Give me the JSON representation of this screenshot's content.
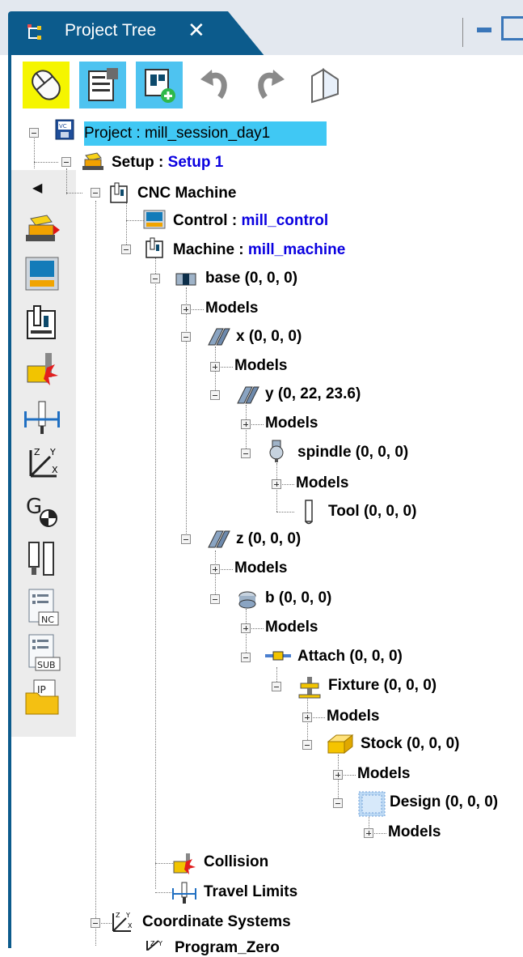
{
  "tab": {
    "title": "Project Tree",
    "close": "✕"
  },
  "toolbar": {
    "buttons": [
      {
        "name": "select-mode-icon"
      },
      {
        "name": "properties-icon"
      },
      {
        "name": "add-component-icon"
      },
      {
        "name": "undo-icon"
      },
      {
        "name": "redo-icon"
      },
      {
        "name": "view-icon"
      }
    ]
  },
  "sidebar": {
    "collapse_arrow": "◀",
    "buttons": [
      {
        "name": "setup-icon"
      },
      {
        "name": "control-icon"
      },
      {
        "name": "machine-icon"
      },
      {
        "name": "collision-icon"
      },
      {
        "name": "travel-limits-icon"
      },
      {
        "name": "coordinate-systems-icon"
      },
      {
        "name": "g-code-offsets-icon"
      },
      {
        "name": "tools-icon"
      },
      {
        "name": "nc-programs-icon",
        "label": "NC"
      },
      {
        "name": "subroutines-icon",
        "label": "SUB"
      },
      {
        "name": "ip-folder-icon",
        "label": "IP"
      }
    ]
  },
  "tree": {
    "project": {
      "label": "Project : mill_session_day1"
    },
    "setup": {
      "label": "Setup :",
      "value": "Setup 1"
    },
    "cnc_machine": {
      "label": "CNC Machine"
    },
    "control": {
      "label": "Control :",
      "value": "mill_control"
    },
    "machine": {
      "label": "Machine :",
      "value": "mill_machine"
    },
    "base": {
      "label": "base (0, 0, 0)"
    },
    "base_models": {
      "label": "Models"
    },
    "x": {
      "label": "x (0, 0, 0)"
    },
    "x_models": {
      "label": "Models"
    },
    "y": {
      "label": "y (0, 22, 23.6)"
    },
    "y_models": {
      "label": "Models"
    },
    "spindle": {
      "label": "spindle (0, 0, 0)"
    },
    "spindle_models": {
      "label": "Models"
    },
    "tool": {
      "label": "Tool (0, 0, 0)"
    },
    "z": {
      "label": "z (0, 0, 0)"
    },
    "z_models": {
      "label": "Models"
    },
    "b": {
      "label": "b (0, 0, 0)"
    },
    "b_models": {
      "label": "Models"
    },
    "attach": {
      "label": "Attach (0, 0, 0)"
    },
    "fixture": {
      "label": "Fixture (0, 0, 0)"
    },
    "fixture_models": {
      "label": "Models"
    },
    "stock": {
      "label": "Stock (0, 0, 0)"
    },
    "stock_models": {
      "label": "Models"
    },
    "design": {
      "label": "Design (0, 0, 0)"
    },
    "design_models": {
      "label": "Models"
    },
    "collision": {
      "label": "Collision"
    },
    "travel_limits": {
      "label": "Travel Limits"
    },
    "coordinate_systems": {
      "label": "Coordinate Systems"
    },
    "program_zero": {
      "label": "Program_Zero"
    }
  }
}
